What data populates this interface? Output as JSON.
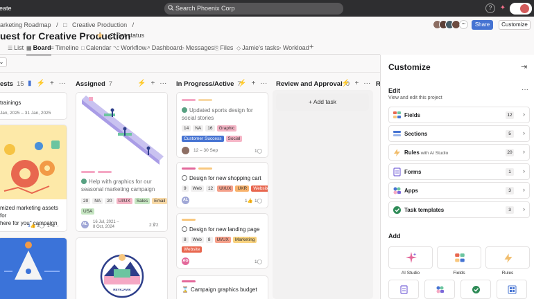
{
  "topbar": {
    "create_label": "reate",
    "search_placeholder": "Search Phoenix Corp",
    "help_label": "?",
    "spark_label": "✦"
  },
  "header": {
    "breadcrumb": [
      "arketing Roadmap",
      "/",
      "Creative Production",
      "/"
    ],
    "title": "uest for Creative Production",
    "set_status": "Set status",
    "share_label": "Share",
    "customize_label": "Customize",
    "members_more": "•••"
  },
  "tabs": [
    {
      "icon": "☰",
      "label": "List"
    },
    {
      "icon": "▦",
      "label": "Board"
    },
    {
      "icon": "≡",
      "label": "Timeline"
    },
    {
      "icon": "□",
      "label": "Calendar"
    },
    {
      "icon": "⌥",
      "label": "Workflow"
    },
    {
      "icon": "↗",
      "label": "Dashboard"
    },
    {
      "icon": "○",
      "label": "Messages"
    },
    {
      "icon": "⎘",
      "label": "Files"
    },
    {
      "icon": "◇",
      "label": "Jamie's tasks"
    },
    {
      "icon": "◔",
      "label": "Workload"
    },
    {
      "icon": "+",
      "label": ""
    }
  ],
  "board": {
    "columns": [
      {
        "title": "ests",
        "count": "15"
      },
      {
        "title": "Assigned",
        "count": "7"
      },
      {
        "title": "In Progress/Active",
        "count": "7"
      },
      {
        "title": "Review and Approval",
        "count": "0"
      },
      {
        "title": "R",
        "count": ""
      }
    ],
    "add_task_label": "+ Add task",
    "cards": {
      "c1_title": "trainings",
      "c1_date": "Jan, 2025 – 31 Jan, 2025",
      "c2_title_1": "mized marketing assets for",
      "c2_title_2": "here for you\" campaign",
      "c2_likes": "3👍",
      "c2_comments": "3◯",
      "c2_sub": "1‣2→",
      "a1_title": "Help with graphics for our seasonal marketing campaign",
      "a1_chips": [
        "20",
        "NA",
        "20",
        "UI/UX",
        "Sales",
        "Email",
        "USA"
      ],
      "a1_date": "16 Jul, 2021 –\n8 Oct, 2024",
      "a1_sub": "2 ℣2",
      "a1_avatar": "AL",
      "p1_title": "Updated sports design for social stories",
      "p1_chips": [
        "14",
        "NA",
        "16",
        "Graphic"
      ],
      "p1_chips2": [
        "Customer Success",
        "Social"
      ],
      "p1_date": "12 – 30 Sep",
      "p1_comments": "1◯",
      "p2_title": "Design for new shopping cart",
      "p2_chips": [
        "9",
        "Web",
        "12",
        "UI/UX",
        "UXR",
        "Website"
      ],
      "p2_avatar": "AL",
      "p2_likes": "1👍",
      "p2_comments": "1◯",
      "p3_title": "Design for new landing page",
      "p3_chips": [
        "8",
        "Web",
        "8",
        "UI/UX",
        "Marketing"
      ],
      "p3_chips2": [
        "Website"
      ],
      "p3_avatar": "AG",
      "p3_comments": "1◯",
      "p4_title": "Campaign graphics budget",
      "badge_text": "REYKJAVIK"
    }
  },
  "panel": {
    "title": "Customize",
    "edit_heading": "Edit",
    "edit_sub": "View and edit this project",
    "rows": [
      {
        "label": "Fields",
        "extra": "",
        "count": "12",
        "icon": "fields-icon"
      },
      {
        "label": "Sections",
        "extra": "",
        "count": "5",
        "icon": "sections-icon"
      },
      {
        "label": "Rules",
        "extra": "with AI Studio",
        "count": "20",
        "icon": "rules-icon"
      },
      {
        "label": "Forms",
        "extra": "",
        "count": "1",
        "icon": "forms-icon"
      },
      {
        "label": "Apps",
        "extra": "",
        "count": "3",
        "icon": "apps-icon"
      },
      {
        "label": "Task templates",
        "extra": "",
        "count": "3",
        "icon": "task-templates-icon"
      }
    ],
    "add_heading": "Add",
    "tiles": [
      "AI Studio",
      "Fields",
      "Rules"
    ]
  },
  "colors": {
    "topbar": "#2e2e30",
    "accent_blue": "#4573d2",
    "success_green": "#58a182",
    "pink_bar": "#f5a8c4",
    "orange_bar": "#f8c77e"
  }
}
